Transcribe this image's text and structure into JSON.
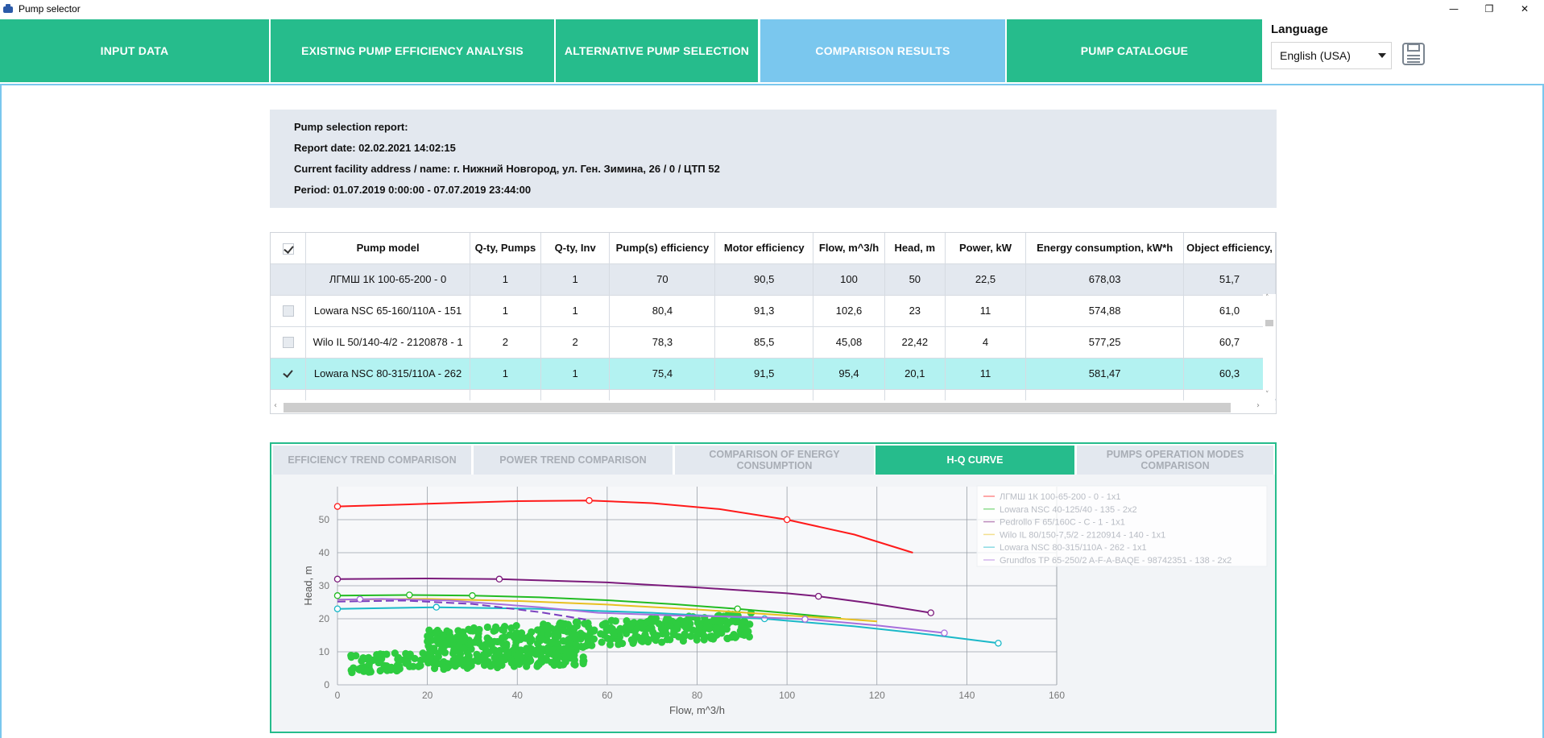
{
  "window": {
    "title": "Pump selector",
    "minimize_glyph": "—",
    "maximize_glyph": "❐",
    "close_glyph": "✕"
  },
  "nav": {
    "tabs": [
      {
        "label": "INPUT DATA"
      },
      {
        "label": "EXISTING PUMP EFFICIENCY ANALYSIS"
      },
      {
        "label": "ALTERNATIVE PUMP SELECTION"
      },
      {
        "label": "COMPARISON RESULTS"
      },
      {
        "label": "PUMP CATALOGUE"
      }
    ],
    "active_tab": "COMPARISON RESULTS",
    "language_label": "Language",
    "language_value": "English (USA)"
  },
  "report": {
    "title": "Pump selection report:",
    "date": "Report date:  02.02.2021 14:02:15",
    "address": "Current facility address / name:  г. Нижний Новгород, ул. Ген. Зимина, 26 / 0 / ЦТП 52",
    "period": "Period:  01.07.2019 0:00:00 - 07.07.2019 23:44:00"
  },
  "table": {
    "columns": [
      "Pump model",
      "Q-ty, Pumps",
      "Q-ty, Inv",
      "Pump(s) efficiency",
      "Motor efficiency",
      "Flow, m^3/h",
      "Head, m",
      "Power, kW",
      "Energy consumption, kW*h",
      "Object efficiency,"
    ],
    "rows": [
      {
        "kind": "reference",
        "checked": false,
        "cells": [
          "ЛГМШ 1К 100-65-200 - 0",
          "1",
          "1",
          "70",
          "90,5",
          "100",
          "50",
          "22,5",
          "678,03",
          "51,7"
        ]
      },
      {
        "kind": "normal",
        "checked": false,
        "cells": [
          "Lowara NSC 65-160/110A - 151",
          "1",
          "1",
          "80,4",
          "91,3",
          "102,6",
          "23",
          "11",
          "574,88",
          "61,0"
        ]
      },
      {
        "kind": "normal",
        "checked": false,
        "cells": [
          "Wilo IL 50/140-4/2 - 2120878 - 1",
          "2",
          "2",
          "78,3",
          "85,5",
          "45,08",
          "22,42",
          "4",
          "577,25",
          "60,7"
        ]
      },
      {
        "kind": "selected",
        "checked": true,
        "cells": [
          "Lowara NSC 80-315/110A - 262",
          "1",
          "1",
          "75,4",
          "91,5",
          "95,4",
          "20,1",
          "11",
          "581,47",
          "60,3"
        ]
      }
    ],
    "scroll_up": "˄",
    "scroll_down": "˅",
    "scroll_left": "‹",
    "scroll_right": "›"
  },
  "chart_tabs": [
    {
      "label": "EFFICIENCY TREND COMPARISON"
    },
    {
      "label": "POWER TREND COMPARISON"
    },
    {
      "label": "COMPARISON OF ENERGY CONSUMPTION"
    },
    {
      "label": "H-Q CURVE"
    },
    {
      "label": "PUMPS OPERATION MODES COMPARISON"
    }
  ],
  "chart_data": {
    "type": "line",
    "xlabel": "Flow, m^3/h",
    "ylabel": "Head, m",
    "xlim": [
      0,
      160
    ],
    "ylim": [
      0,
      60
    ],
    "xticks": [
      0,
      20,
      40,
      60,
      80,
      100,
      120,
      140,
      160
    ],
    "yticks": [
      0,
      10,
      20,
      30,
      40,
      50
    ],
    "grid": true,
    "legend_position": "top-right",
    "series": [
      {
        "name": "ЛГМШ 1К 100-65-200 - 0 - 1x1",
        "color": "#ff1a1a",
        "x": [
          0,
          20,
          40,
          56,
          70,
          85,
          100,
          115,
          128
        ],
        "y": [
          54,
          54.8,
          55.6,
          55.8,
          55,
          53.2,
          50,
          45.5,
          40
        ],
        "markers": [
          0,
          56,
          100
        ]
      },
      {
        "name": "Lowara NSC 40-125/40 - 135 - 2x2",
        "color": "#22bb22",
        "x": [
          0,
          16,
          30,
          45,
          60,
          75,
          89,
          100,
          112
        ],
        "y": [
          27,
          27.2,
          27,
          26.5,
          25.6,
          24.4,
          23,
          21.7,
          20.2
        ],
        "markers": [
          0,
          16,
          30,
          89
        ]
      },
      {
        "name": "Pedrollo F 65/160C - C - 1 - 1x1",
        "color": "#7b1a7b",
        "x": [
          0,
          20,
          36,
          60,
          80,
          100,
          107,
          118,
          132
        ],
        "y": [
          32,
          32.2,
          32,
          31,
          29.5,
          27.7,
          26.8,
          24.8,
          21.8
        ],
        "markers": [
          0,
          36,
          107,
          132
        ]
      },
      {
        "name": "Wilo IL 80/150-7,5/2 - 2120914 - 140 - 1x1",
        "color": "#e8c020",
        "x": [
          0,
          20,
          40,
          60,
          80,
          100,
          110,
          120
        ],
        "y": [
          25.8,
          26,
          25.4,
          24.3,
          22.8,
          21,
          20.2,
          19.2
        ],
        "markers": []
      },
      {
        "name": "Lowara NSC 80-315/110A - 262 - 1x1",
        "color": "#1ab8c8",
        "x": [
          0,
          22,
          45,
          70,
          95,
          115,
          132,
          147
        ],
        "y": [
          23,
          23.5,
          23,
          21.8,
          20,
          17.7,
          15.2,
          12.6
        ],
        "markers": [
          0,
          22,
          95,
          147
        ]
      },
      {
        "name": "Grundfos TP 65-250/2 A-F-A-BAQE - 98742351 - 138 - 2x2",
        "color": "#a76fdc",
        "x": [
          0,
          10,
          25,
          45,
          58,
          75,
          92,
          105,
          120,
          135
        ],
        "y": [
          25.8,
          26,
          25.5,
          23.5,
          21.8,
          21,
          20.5,
          19.8,
          18,
          15.7
        ],
        "markers": [
          5,
          104,
          135
        ]
      }
    ],
    "dashed_series": [
      {
        "color": "#7a3fbf",
        "x": [
          0,
          15,
          30,
          45,
          56
        ],
        "y": [
          25.2,
          25.5,
          24.5,
          22,
          19.6
        ]
      }
    ],
    "scatter": {
      "color": "#2ecc40",
      "cluster_a": {
        "x_range": [
          3,
          55
        ],
        "y_range": [
          4.5,
          12
        ]
      },
      "cluster_b": {
        "x_range": [
          20,
          92
        ],
        "y_range": [
          11,
          21
        ]
      }
    }
  }
}
